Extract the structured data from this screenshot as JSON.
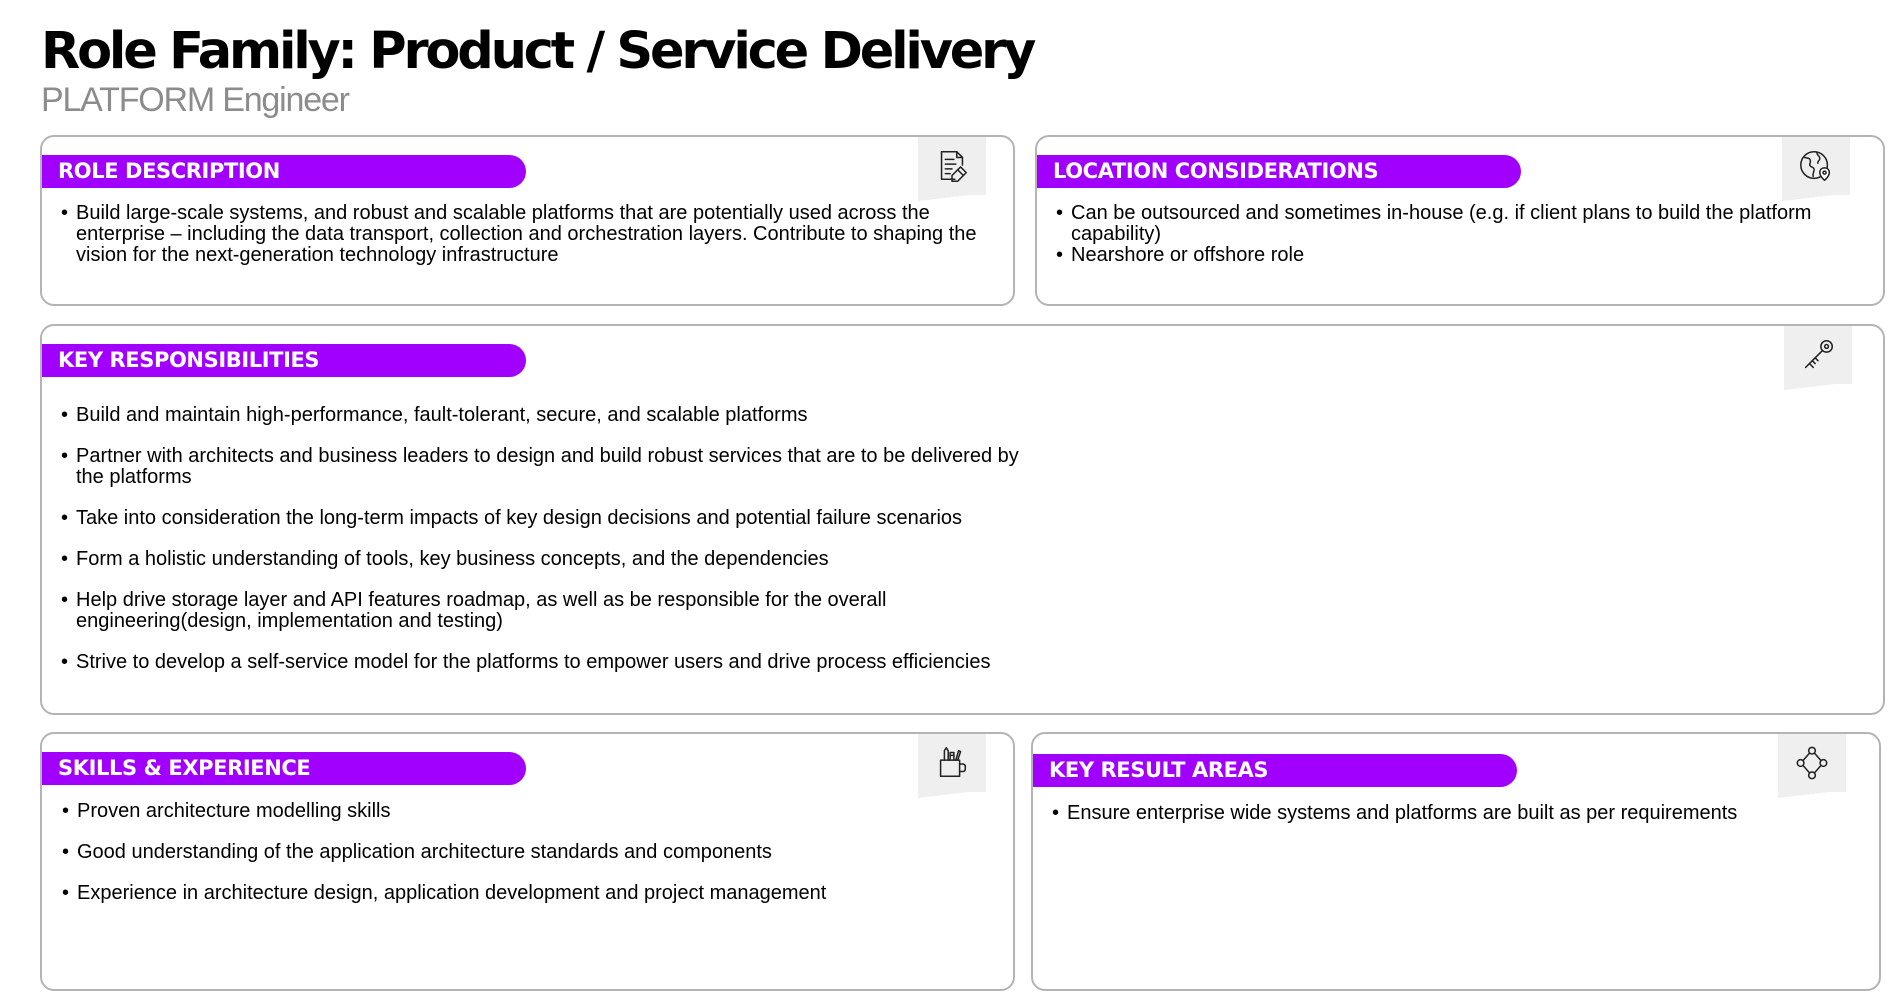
{
  "header": {
    "title": "Role Family: Product / Service Delivery",
    "subtitle": "PLATFORM Engineer"
  },
  "colors": {
    "accent": "#a100ff",
    "card_border": "#b4b4b4",
    "icon_bg": "#efefef",
    "subtitle": "#8c8c8c"
  },
  "role_description": {
    "label": "ROLE DESCRIPTION",
    "icon": "document-edit-icon",
    "bullets": [
      "Build large-scale systems, and robust and scalable platforms that are potentially used across the enterprise – including the data transport, collection and orchestration layers. Contribute to shaping the vision for the next-generation technology infrastructure"
    ]
  },
  "location_considerations": {
    "label": "LOCATION CONSIDERATIONS",
    "icon": "globe-location-icon",
    "bullets": [
      "Can be outsourced and sometimes in-house (e.g. if client plans to build the platform capability)",
      "Nearshore or offshore role"
    ]
  },
  "key_responsibilities": {
    "label": "KEY RESPONSIBILITIES",
    "icon": "key-icon",
    "bullets": [
      "Build and maintain high-performance, fault-tolerant, secure, and scalable platforms",
      "Partner with architects and business leaders to design and build robust services that are to be delivered by the platforms",
      "Take into consideration the long-term impacts of key design decisions and potential failure scenarios",
      "Form a holistic understanding of tools, key business concepts, and the dependencies",
      "Help drive storage layer and API features roadmap, as well as be responsible for the overall engineering(design, implementation and testing)",
      "Strive to develop a self-service model for the platforms to empower users and drive process efficiencies"
    ]
  },
  "skills_experience": {
    "label": "SKILLS & EXPERIENCE",
    "icon": "tools-cup-icon",
    "bullets": [
      "Proven architecture modelling skills",
      "Good understanding of the application architecture standards and components",
      "Experience in architecture design, application development and project management"
    ]
  },
  "key_result_areas": {
    "label": "KEY RESULT AREAS",
    "icon": "network-nodes-icon",
    "bullets": [
      "Ensure enterprise wide systems and platforms are built as per requirements"
    ]
  }
}
